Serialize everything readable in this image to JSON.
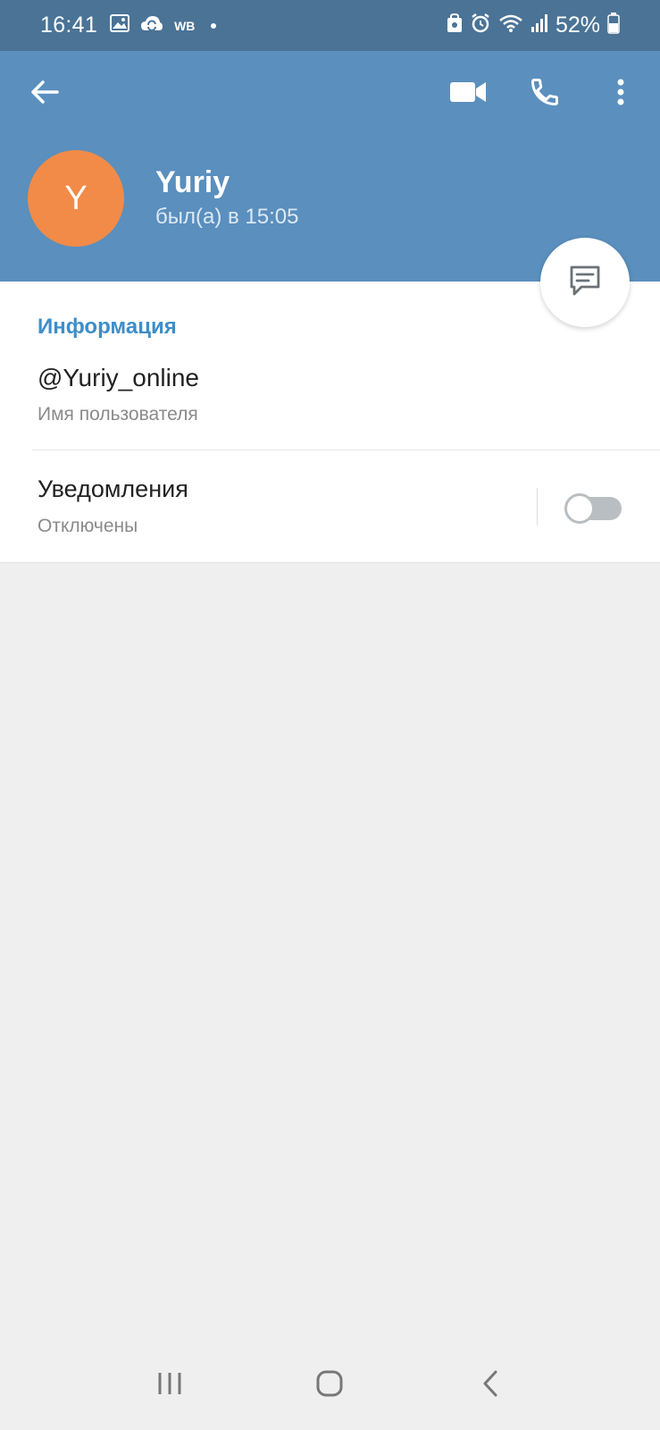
{
  "status_bar": {
    "time": "16:41",
    "carrier_badge": "WB",
    "battery": "52%"
  },
  "header": {
    "name": "Yuriy",
    "last_seen": "был(а) в 15:05",
    "avatar_letter": "Y",
    "avatar_color": "#f18b47",
    "bar_color": "#5a8fbe"
  },
  "info": {
    "section_title": "Информация",
    "username": "@Yuriy_online",
    "username_label": "Имя пользователя",
    "notifications_title": "Уведомления",
    "notifications_state": "Отключены",
    "notifications_enabled": false
  },
  "icons": {
    "back": "arrow-left-icon",
    "video": "video-camera-icon",
    "call": "phone-icon",
    "menu": "more-vertical-icon",
    "message": "message-icon"
  }
}
